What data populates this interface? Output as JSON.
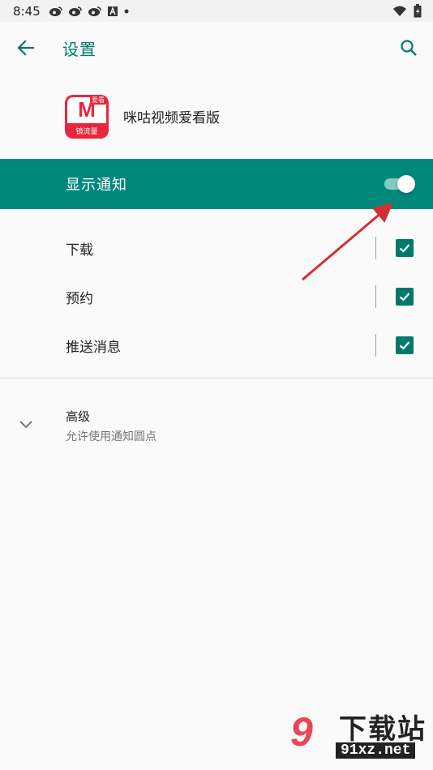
{
  "status_bar": {
    "time": "8:45",
    "icons": [
      "weibo-icon",
      "weibo-icon",
      "weibo-icon",
      "a-icon",
      "dot-icon"
    ],
    "right_icons": [
      "wifi-icon",
      "battery-icon"
    ]
  },
  "app_bar": {
    "title": "设置"
  },
  "app": {
    "name": "咪咕视频爱看版",
    "logo_letter": "M",
    "logo_tag": "爱看",
    "logo_bottom": "镜流量"
  },
  "notify": {
    "label": "显示通知",
    "enabled": true
  },
  "channels": [
    {
      "label": "下载",
      "checked": true
    },
    {
      "label": "预约",
      "checked": true
    },
    {
      "label": "推送消息",
      "checked": true
    }
  ],
  "advanced": {
    "title": "高级",
    "subtitle": "允许使用通知圆点"
  },
  "watermark": {
    "logo": "9",
    "text": "下载站",
    "url": "91xz.net"
  },
  "colors": {
    "accent": "#00897b",
    "accent_dark": "#00796b",
    "arrow": "#d32f2f"
  }
}
